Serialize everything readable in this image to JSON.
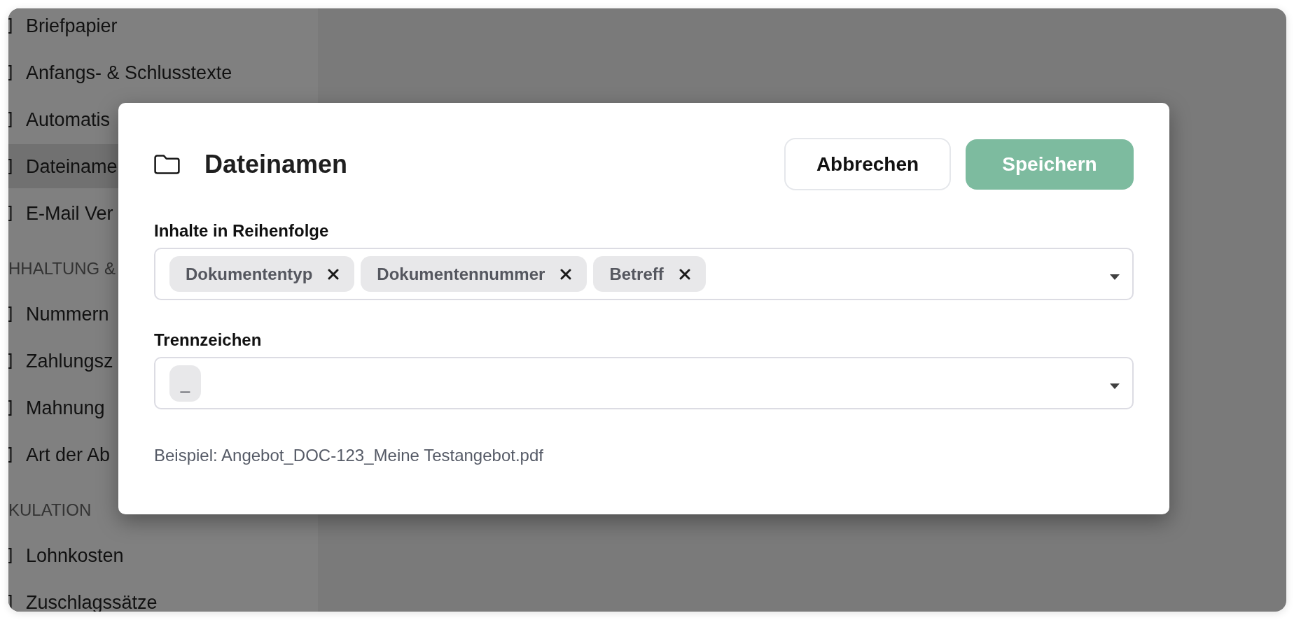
{
  "sidebar": {
    "items": [
      {
        "kind": "item",
        "label": "Briefpapier",
        "selected": false
      },
      {
        "kind": "item",
        "label": "Anfangs- & Schlusstexte",
        "selected": false
      },
      {
        "kind": "item",
        "label": "Automatis",
        "selected": false
      },
      {
        "kind": "item",
        "label": "Dateiname",
        "selected": true
      },
      {
        "kind": "item",
        "label": "E-Mail Ver",
        "selected": false
      },
      {
        "kind": "heading",
        "label": "HHALTUNG &"
      },
      {
        "kind": "item",
        "label": "Nummern",
        "selected": false
      },
      {
        "kind": "item",
        "label": "Zahlungsz",
        "selected": false
      },
      {
        "kind": "item",
        "label": "Mahnung",
        "selected": false
      },
      {
        "kind": "item",
        "label": "Art der Ab",
        "selected": false
      },
      {
        "kind": "heading",
        "label": "KULATION"
      },
      {
        "kind": "item",
        "label": "Lohnkosten",
        "selected": false
      },
      {
        "kind": "item",
        "label": "Zuschlagssätze",
        "selected": false
      }
    ]
  },
  "dialog": {
    "title": "Dateinamen",
    "buttons": [
      {
        "label": "Abbrechen",
        "kind": "secondary"
      },
      {
        "label": "Speichern",
        "kind": "primary"
      }
    ],
    "fields": [
      {
        "label": "Inhalte in Reihenfolge",
        "tags": [
          {
            "label": "Dokumententyp",
            "removable": true
          },
          {
            "label": "Dokumentennummer",
            "removable": true
          },
          {
            "label": "Betreff",
            "removable": true
          }
        ]
      },
      {
        "label": "Trennzeichen",
        "tags": [
          {
            "label": "_",
            "removable": false
          }
        ]
      }
    ],
    "example": "Beispiel: Angebot_DOC-123_Meine Testangebot.pdf"
  }
}
